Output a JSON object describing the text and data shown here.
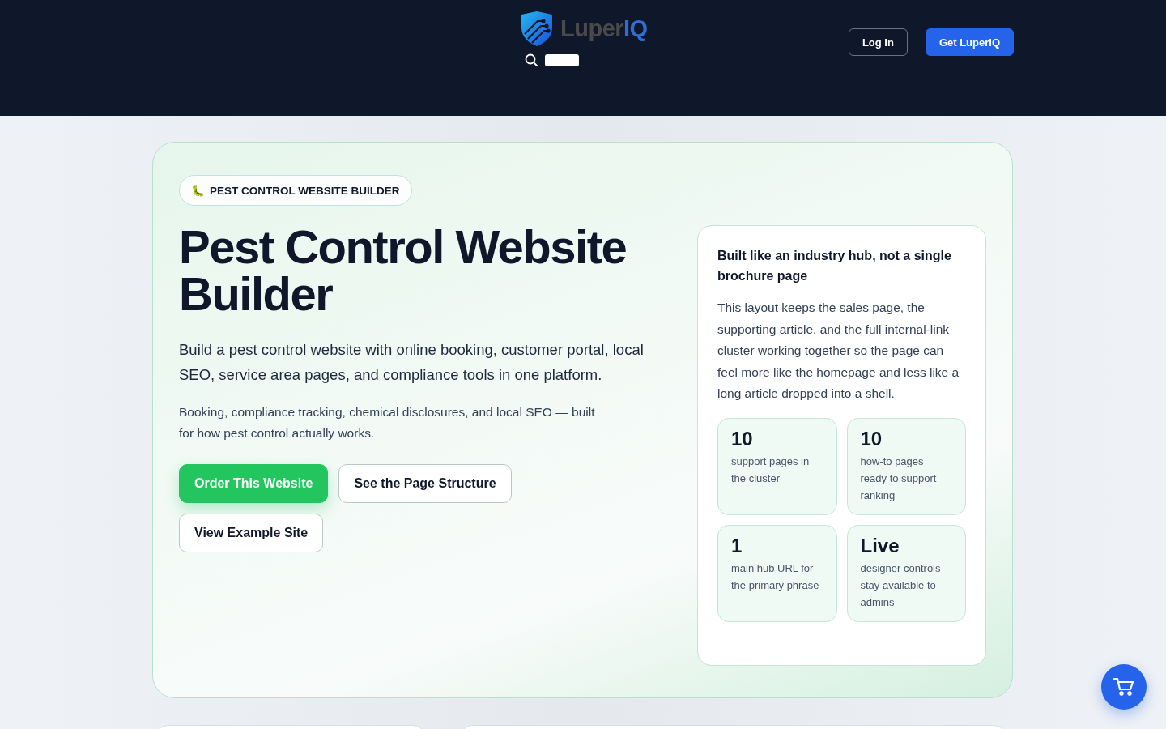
{
  "header": {
    "logo": {
      "text_start": "Luper",
      "text_end": "IQ"
    },
    "search": {
      "kind": "search"
    },
    "buttons": [
      {
        "label": "Log In",
        "kind": "outline"
      },
      {
        "label": "Get LuperIQ",
        "kind": "primary"
      }
    ]
  },
  "hero": {
    "badge": {
      "emoji": "🐛",
      "label": "PEST CONTROL WEBSITE BUILDER"
    },
    "title": "Pest Control Website Builder",
    "lead": "Build a pest control website with online booking, customer portal, local SEO, service area pages, and compliance tools in one platform.",
    "sub": "Booking, compliance tracking, chemical disclosures, and local SEO — built for how pest control actually works.",
    "actions": [
      {
        "label": "Order This Website",
        "kind": "primary"
      },
      {
        "label": "See the Page Structure",
        "kind": "outline"
      },
      {
        "label": "View Example Site",
        "kind": "outline"
      }
    ],
    "panel": {
      "title": "Built like an industry hub, not a single brochure page",
      "text": "This layout keeps the sales page, the supporting article, and the full internal-link cluster working together so the page can feel more like the homepage and less like a long article dropped into a shell.",
      "stats": [
        {
          "value": "10",
          "label": "support pages in the cluster"
        },
        {
          "value": "10",
          "label": "how-to pages ready to support ranking"
        },
        {
          "value": "1",
          "label": "main hub URL for the primary phrase"
        },
        {
          "value": "Live",
          "label": "designer controls stay available to admins"
        }
      ]
    }
  },
  "cart_button": {
    "kind": "cart"
  }
}
